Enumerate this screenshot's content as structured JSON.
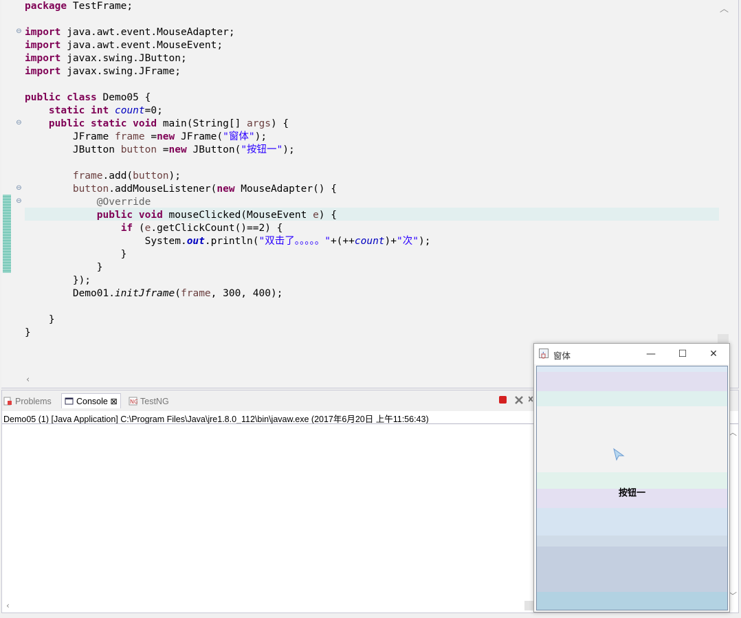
{
  "editor": {
    "lines": [
      [
        {
          "t": "package",
          "c": "kw"
        },
        {
          "t": " TestFrame;"
        }
      ],
      [],
      [
        {
          "t": "import",
          "c": "kw"
        },
        {
          "t": " java.awt.event.MouseAdapter;"
        }
      ],
      [
        {
          "t": "import",
          "c": "kw"
        },
        {
          "t": " java.awt.event.MouseEvent;"
        }
      ],
      [
        {
          "t": "import",
          "c": "kw"
        },
        {
          "t": " javax.swing.JButton;"
        }
      ],
      [
        {
          "t": "import",
          "c": "kw"
        },
        {
          "t": " javax.swing.JFrame;"
        }
      ],
      [],
      [
        {
          "t": "public",
          "c": "kw"
        },
        {
          "t": " "
        },
        {
          "t": "class",
          "c": "kw"
        },
        {
          "t": " Demo05 {"
        }
      ],
      [
        {
          "t": "    "
        },
        {
          "t": "static",
          "c": "kw"
        },
        {
          "t": " "
        },
        {
          "t": "int",
          "c": "kw"
        },
        {
          "t": " "
        },
        {
          "t": "count",
          "c": "fld"
        },
        {
          "t": "=0;"
        }
      ],
      [
        {
          "t": "    "
        },
        {
          "t": "public",
          "c": "kw"
        },
        {
          "t": " "
        },
        {
          "t": "static",
          "c": "kw"
        },
        {
          "t": " "
        },
        {
          "t": "void",
          "c": "kw"
        },
        {
          "t": " main(String[] "
        },
        {
          "t": "args",
          "c": "var"
        },
        {
          "t": ") {"
        }
      ],
      [
        {
          "t": "        JFrame "
        },
        {
          "t": "frame",
          "c": "var"
        },
        {
          "t": " ="
        },
        {
          "t": "new",
          "c": "kw"
        },
        {
          "t": " JFrame("
        },
        {
          "t": "\"窗体\"",
          "c": "str"
        },
        {
          "t": ");"
        }
      ],
      [
        {
          "t": "        JButton "
        },
        {
          "t": "button",
          "c": "var"
        },
        {
          "t": " ="
        },
        {
          "t": "new",
          "c": "kw"
        },
        {
          "t": " JButton("
        },
        {
          "t": "\"按钮一\"",
          "c": "str"
        },
        {
          "t": ");"
        }
      ],
      [],
      [
        {
          "t": "        "
        },
        {
          "t": "frame",
          "c": "var"
        },
        {
          "t": ".add("
        },
        {
          "t": "button",
          "c": "var"
        },
        {
          "t": ");"
        }
      ],
      [
        {
          "t": "        "
        },
        {
          "t": "button",
          "c": "var"
        },
        {
          "t": ".addMouseListener("
        },
        {
          "t": "new",
          "c": "kw"
        },
        {
          "t": " MouseAdapter() {"
        }
      ],
      [
        {
          "t": "            "
        },
        {
          "t": "@Override",
          "c": "ann"
        }
      ],
      [
        {
          "t": "            "
        },
        {
          "t": "public",
          "c": "kw"
        },
        {
          "t": " "
        },
        {
          "t": "void",
          "c": "kw"
        },
        {
          "t": " mouseClicked(MouseEvent "
        },
        {
          "t": "e",
          "c": "var"
        },
        {
          "t": ") {"
        }
      ],
      [
        {
          "t": "                "
        },
        {
          "t": "if",
          "c": "kw"
        },
        {
          "t": " ("
        },
        {
          "t": "e",
          "c": "var"
        },
        {
          "t": ".getClickCount()==2) {"
        }
      ],
      [
        {
          "t": "                    System."
        },
        {
          "t": "out",
          "c": "sfld"
        },
        {
          "t": ".println("
        },
        {
          "t": "\"双击了。。。。。\"",
          "c": "str"
        },
        {
          "t": "+(++"
        },
        {
          "t": "count",
          "c": "fld"
        },
        {
          "t": ")+"
        },
        {
          "t": "\"次\"",
          "c": "str"
        },
        {
          "t": ");"
        }
      ],
      [
        {
          "t": "                }"
        }
      ],
      [
        {
          "t": "            }"
        }
      ],
      [
        {
          "t": "        });"
        }
      ],
      [
        {
          "t": "        Demo01."
        },
        {
          "t": "initJframe",
          "c": "smeth"
        },
        {
          "t": "("
        },
        {
          "t": "frame",
          "c": "var"
        },
        {
          "t": ", 300, 400);"
        }
      ],
      [],
      [
        {
          "t": "    }"
        }
      ],
      [
        {
          "t": "}"
        }
      ]
    ]
  },
  "views": {
    "tabs": [
      {
        "label": "Problems"
      },
      {
        "label": "Console ⊠"
      },
      {
        "label": "TestNG"
      }
    ],
    "status": "Demo05 (1) [Java Application] C:\\Program Files\\Java\\jre1.8.0_112\\bin\\javaw.exe (2017年6月20日 上午11:56:43)"
  },
  "jframe": {
    "title": "窗体",
    "button_label": "按钮一"
  },
  "colors": {
    "keyword": "#7f0055",
    "string": "#2a00ff",
    "field": "#0000c0",
    "current_line": "#e2efef",
    "change_bar": "#7ccaba"
  }
}
